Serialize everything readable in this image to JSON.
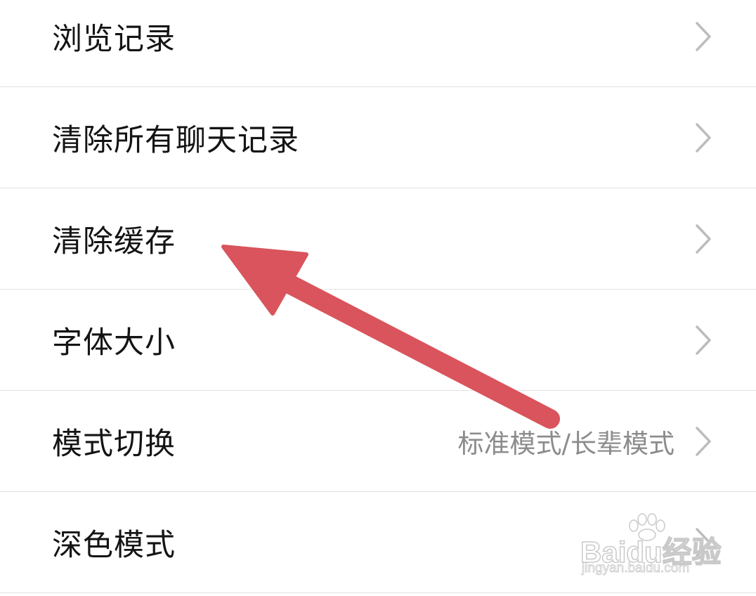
{
  "settings": {
    "items": [
      {
        "label": "浏览记录",
        "value": ""
      },
      {
        "label": "清除所有聊天记录",
        "value": ""
      },
      {
        "label": "清除缓存",
        "value": ""
      },
      {
        "label": "字体大小",
        "value": ""
      },
      {
        "label": "模式切换",
        "value": "标准模式/长辈模式"
      },
      {
        "label": "深色模式",
        "value": ""
      }
    ]
  },
  "icons": {
    "chevron": "chevron-right-icon",
    "annotation": "red-arrow-annotation"
  },
  "colors": {
    "background": "#ffffff",
    "label": "#141414",
    "value": "#8c8c8c",
    "divider": "#e2e2e2",
    "chevron": "#bdbdbd",
    "arrow": "#d9545c"
  },
  "watermark": {
    "brand": "Baidu经验",
    "url": "jingyan.baidu.com"
  }
}
